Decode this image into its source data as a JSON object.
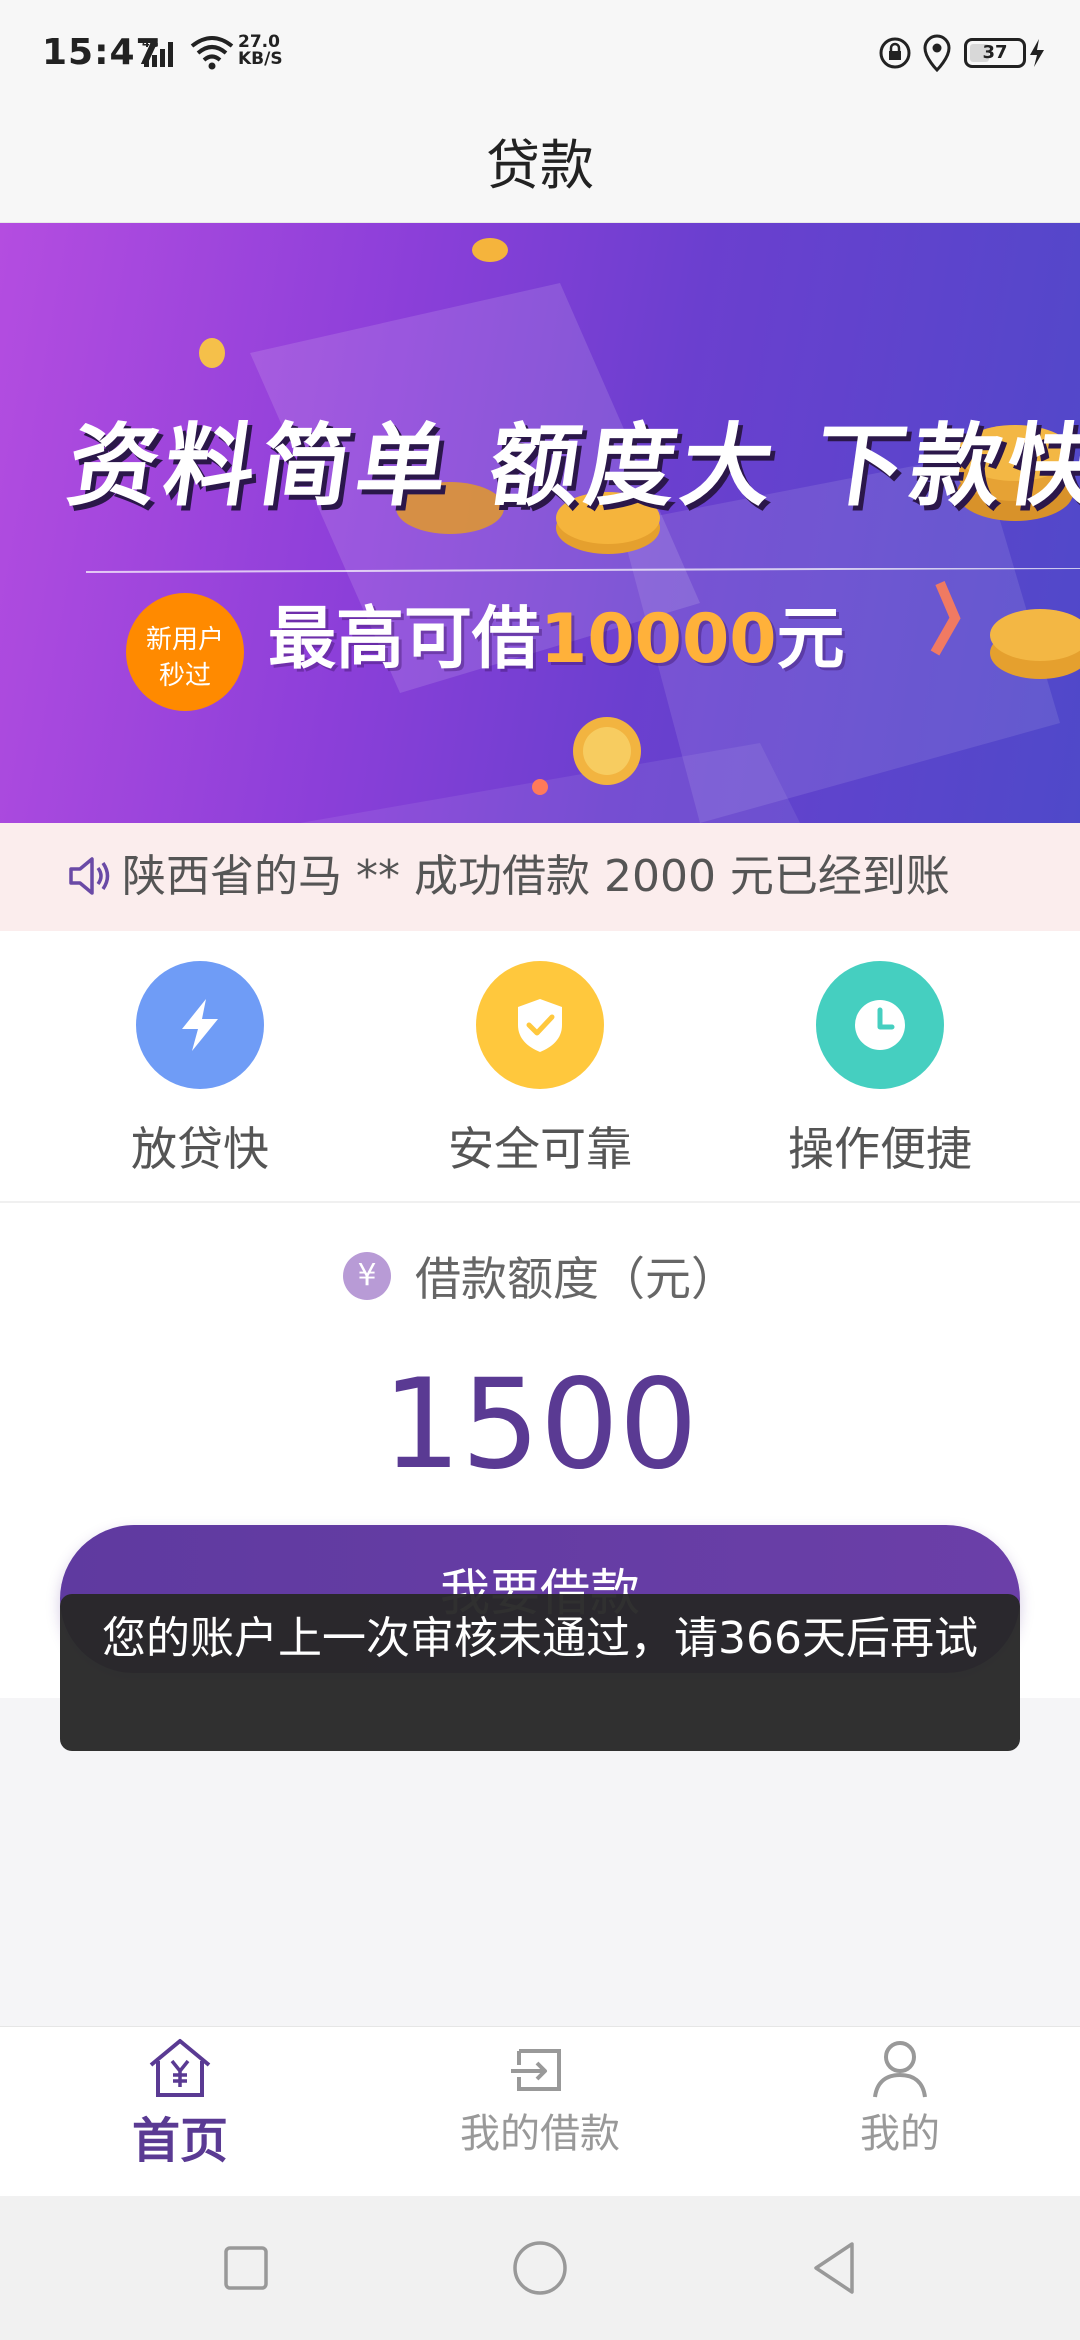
{
  "status_bar": {
    "time": "15:47",
    "network": "4G",
    "speed_value": "27.0",
    "speed_unit": "KB/S",
    "battery": "37"
  },
  "header": {
    "title": "贷款"
  },
  "banner": {
    "headline": "资料简单 额度大 下款快",
    "badge_line1": "新用户",
    "badge_line2": "秒过",
    "sub_prefix": "最高可借",
    "sub_amount": "10000",
    "sub_suffix": "元",
    "active_slide": 1,
    "slide_count": 1
  },
  "notice": {
    "text": "陕西省的马 ** 成功借款 2000 元已经到账",
    "icon": "speaker-icon"
  },
  "features": [
    {
      "label": "放贷快",
      "icon": "lightning-icon",
      "color": "#6f9cf6"
    },
    {
      "label": "安全可靠",
      "icon": "shield-check-icon",
      "color": "#ffc83d"
    },
    {
      "label": "操作便捷",
      "icon": "clock-icon",
      "color": "#45cfc0"
    }
  ],
  "loan": {
    "label": "借款额度（元）",
    "currency_symbol": "¥",
    "amount": "1500",
    "button_label": "我要借款"
  },
  "toast": {
    "text": "您的账户上一次审核未通过，请366天后再试"
  },
  "bottom_nav": [
    {
      "label": "首页",
      "icon": "home-yen-icon",
      "active": true
    },
    {
      "label": "我的借款",
      "icon": "loan-record-icon",
      "active": false
    },
    {
      "label": "我的",
      "icon": "user-icon",
      "active": false
    }
  ],
  "colors": {
    "brand": "#5a3a93",
    "toast_bg": "#282828",
    "notice_bg": "#fbeded",
    "badge": "#ff8a00",
    "banner_amount": "#ffb13a"
  }
}
